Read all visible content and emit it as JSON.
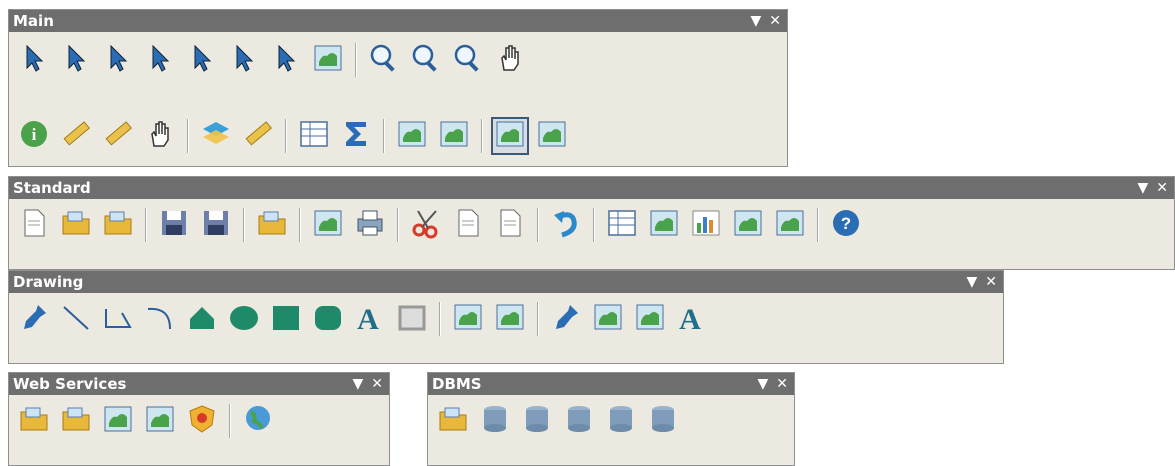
{
  "toolbars": {
    "main": {
      "title": "Main"
    },
    "standard": {
      "title": "Standard"
    },
    "drawing": {
      "title": "Drawing"
    },
    "web_services": {
      "title": "Web Services"
    },
    "dbms": {
      "title": "DBMS"
    }
  },
  "controls": {
    "dropdown_glyph": "▼",
    "close_glyph": "✕"
  },
  "icons": {
    "main_row1": [
      "select-arrow-icon",
      "select-rectangle-icon",
      "select-circle-icon",
      "select-polygon-icon",
      "select-region-icon",
      "clear-selection-icon",
      "select-all-icon",
      "disabled-select-icon",
      "zoom-in-icon",
      "zoom-out-icon",
      "zoom-query-icon",
      "pan-hand-icon"
    ],
    "main_row2": [
      "info-icon",
      "hotlink-icon",
      "label-tag-icon",
      "map-hand-icon",
      "layers-icon",
      "ruler-icon",
      "legend-icon",
      "statistics-sigma-icon",
      "clip-region-icon",
      "change-region-icon",
      "layout-map-icon",
      "map-scissors-icon"
    ],
    "standard": [
      "new-file-icon",
      "open-file-icon",
      "open-workspace-icon",
      "save-icon",
      "save-workspace-icon",
      "open-folder-icon",
      "save-map-icon",
      "print-icon",
      "cut-icon",
      "copy-icon",
      "paste-icon",
      "undo-icon",
      "table-icon",
      "new-map-icon",
      "graph-icon",
      "layout-icon",
      "redistrict-icon",
      "help-icon"
    ],
    "drawing": [
      "symbol-pin-icon",
      "line-icon",
      "polyline-icon",
      "arc-icon",
      "polygon-icon",
      "ellipse-icon",
      "rectangle-icon",
      "rounded-rect-icon",
      "text-icon",
      "frame-icon",
      "reshape-icon",
      "add-node-icon",
      "symbol-style-icon",
      "line-style-icon",
      "region-style-icon",
      "text-style-icon"
    ],
    "web_services": [
      "open-wms-icon",
      "open-universal-icon",
      "wfs-icon",
      "geocode-icon",
      "shield-icon",
      "web-globe-icon"
    ],
    "dbms": [
      "open-dbms-icon",
      "refresh-dbms-icon",
      "unlink-icon",
      "dbms-map-icon",
      "dbms-export-icon",
      "disable-dbms-icon"
    ]
  },
  "colors": {
    "title_bar": "#6e6e6e",
    "toolbar_bg": "#ece9e1",
    "accent_blue": "#2a6db5"
  }
}
